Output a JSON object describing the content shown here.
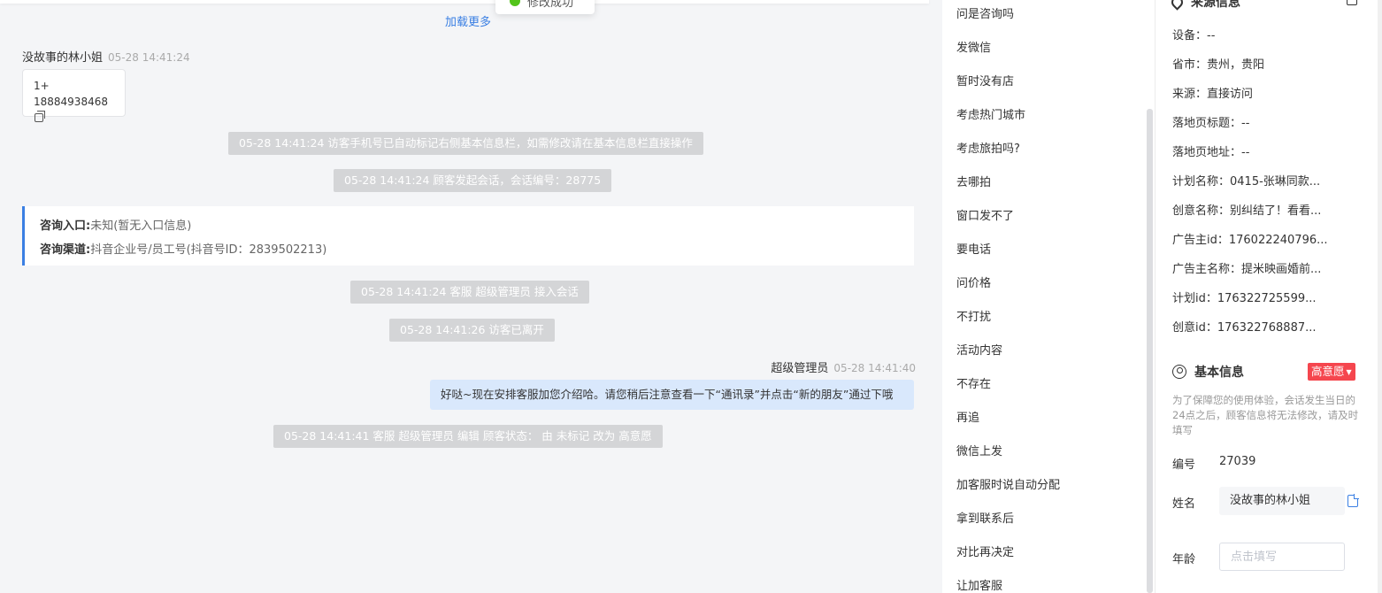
{
  "toast": {
    "text": "修改成功"
  },
  "chat": {
    "load_more": "加载更多",
    "visitor": {
      "name": "没故事的林小姐",
      "time": "05-28 14:41:24"
    },
    "phone_bubble": {
      "line1": "1+",
      "line2": "18884938468"
    },
    "system_messages": [
      "05-28 14:41:24 访客手机号已自动标记右侧基本信息栏，如需修改请在基本信息栏直接操作",
      "05-28 14:41:24 顾客发起会话，会话编号：28775",
      "05-28 14:41:24 客服 超级管理员 接入会话",
      "05-28 14:41:26 访客已离开",
      "05-28 14:41:41 客服 超级管理员 编辑 顾客状态： 由 未标记 改为 高意愿"
    ],
    "entry_card": {
      "entry_label": "咨询入口:",
      "entry_value": "未知(暂无入口信息)",
      "channel_label": "咨询渠道:",
      "channel_value": "抖音企业号/员工号(抖音号ID：2839502213)"
    },
    "agent": {
      "name": "超级管理员",
      "time": "05-28 14:41:40",
      "message": "好哒~现在安排客服加您介绍哈。请您稍后注意查看一下“通讯录”并点击“新的朋友”通过下哦"
    }
  },
  "quick_replies": [
    "问是咨询吗",
    "发微信",
    "暂时没有店",
    "考虑热门城市",
    "考虑旅拍吗?",
    "去哪拍",
    "窗口发不了",
    "要电话",
    "问价格",
    "不打扰",
    "活动内容",
    "不存在",
    "再追",
    "微信上发",
    "加客服时说自动分配",
    "拿到联系后",
    "对比再决定",
    "让加客服"
  ],
  "info": {
    "source_title": "来源信息",
    "source_rows": [
      "设备：--",
      "省市：贵州，贵阳",
      "来源：直接访问",
      "落地页标题：--",
      "落地页地址：--",
      "计划名称：0415-张琳同款...",
      "创意名称：别纠结了！看看...",
      "广告主id：176022240796...",
      "广告主名称：提米映画婚前...",
      "计划id：176322725599...",
      "创意id：176322768887..."
    ],
    "basic_title": "基本信息",
    "intent_badge": "高意愿",
    "notice": "为了保障您的使用体验，会话发生当日的24点之后，顾客信息将无法修改，请及时填写",
    "number_label": "编号",
    "number_value": "27039",
    "name_label": "姓名",
    "name_value": "没故事的林小姐",
    "age_label": "年龄",
    "age_placeholder": "点击填写"
  }
}
